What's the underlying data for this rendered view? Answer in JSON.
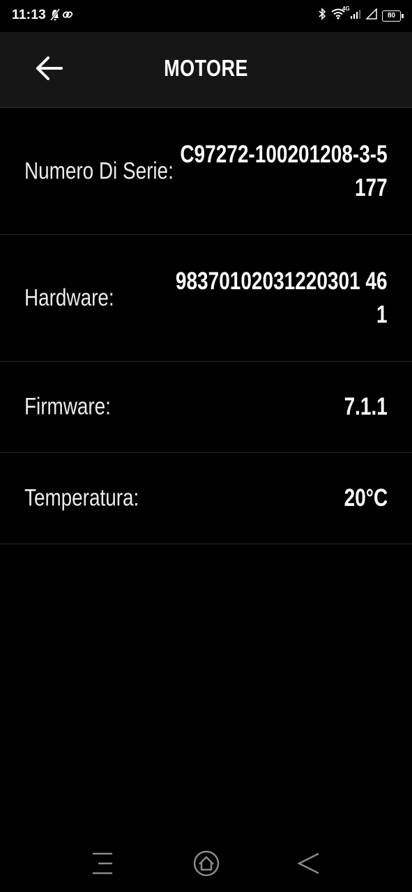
{
  "status_bar": {
    "time": "11:13",
    "network_label": "4G",
    "battery_level": "80",
    "icons": [
      "notification-muted-icon",
      "link-icon",
      "bluetooth-icon",
      "wifi-icon",
      "cell-signal-icon",
      "cell-signal-empty-icon",
      "battery-icon"
    ]
  },
  "header": {
    "title": "MOTORE",
    "back_icon": "arrow-left-icon"
  },
  "rows": [
    {
      "label": "Numero Di Serie:",
      "value_lines": [
        "C97272-100201208-3-5",
        "177"
      ]
    },
    {
      "label": "Hardware:",
      "value_lines": [
        "98370102031220301 46",
        "1"
      ]
    },
    {
      "label": "Firmware:",
      "value": "7.1.1"
    },
    {
      "label": "Temperatura:",
      "value": "20°C"
    }
  ],
  "nav_bar": {
    "icons": [
      "menu-icon",
      "home-icon",
      "back-icon"
    ]
  },
  "colors": {
    "background": "#000000",
    "header_background": "#161616",
    "divider": "#2a2a2a",
    "text": "#ffffff"
  }
}
